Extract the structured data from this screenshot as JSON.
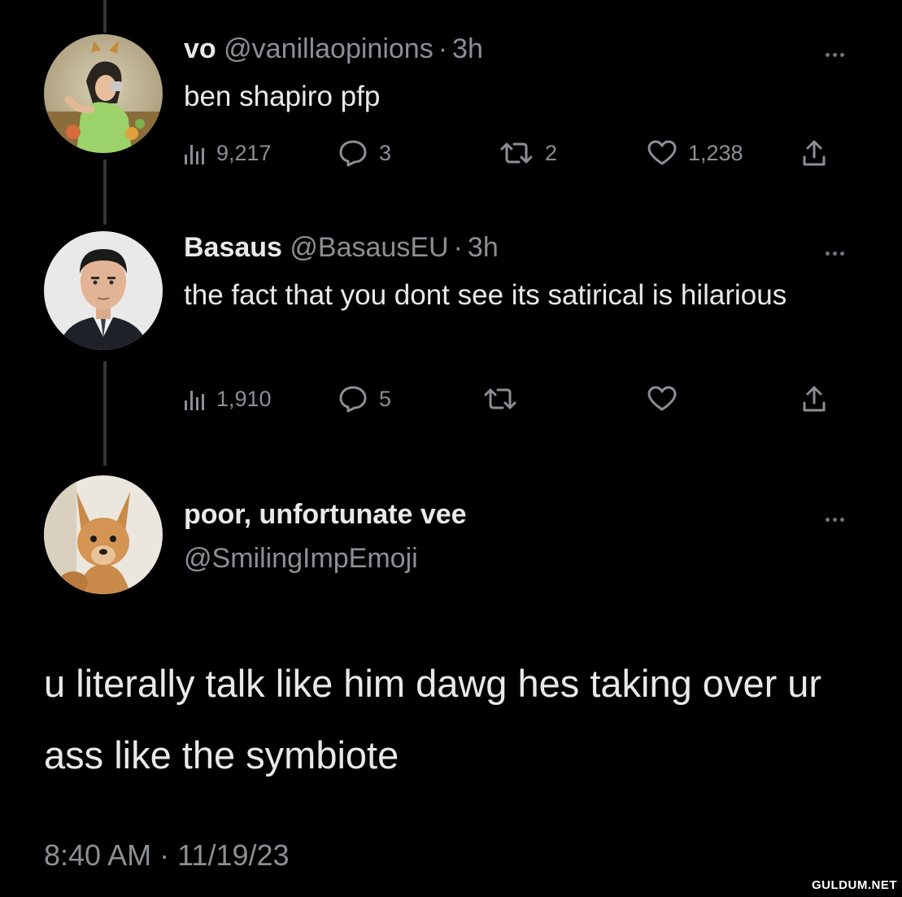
{
  "tweets": [
    {
      "name": "vo",
      "handle": "@vanillaopinions",
      "separator": "·",
      "time": "3h",
      "text": "ben shapiro pfp",
      "avatar_icon": "profile-photo-woman-drinking",
      "stats": {
        "views": "9,217",
        "replies": "3",
        "reposts": "2",
        "likes": "1,238"
      }
    },
    {
      "name": "Basaus",
      "handle": "@BasausEU",
      "separator": "·",
      "time": "3h",
      "text": "the fact that you dont see its satirical is hilarious",
      "avatar_icon": "profile-photo-man-suit",
      "stats": {
        "views": "1,910",
        "replies": "5",
        "reposts": "",
        "likes": ""
      }
    }
  ],
  "main_tweet": {
    "name": "poor, unfortunate vee",
    "handle": "@SmilingImpEmoji",
    "avatar_icon": "profile-photo-chihuahua",
    "text": "u literally talk like him dawg hes taking over ur ass like the symbiote",
    "timestamp": "8:40 AM · 11/19/23"
  },
  "watermark": "GULDUM.NET",
  "colors": {
    "background": "#000000",
    "primary_text": "#e7e9ea",
    "secondary_text": "#8b8f94",
    "thread_line": "#333639"
  },
  "icons": [
    "more-options-icon",
    "views-chart-icon",
    "reply-bubble-icon",
    "repost-icon",
    "like-heart-icon",
    "share-icon"
  ]
}
